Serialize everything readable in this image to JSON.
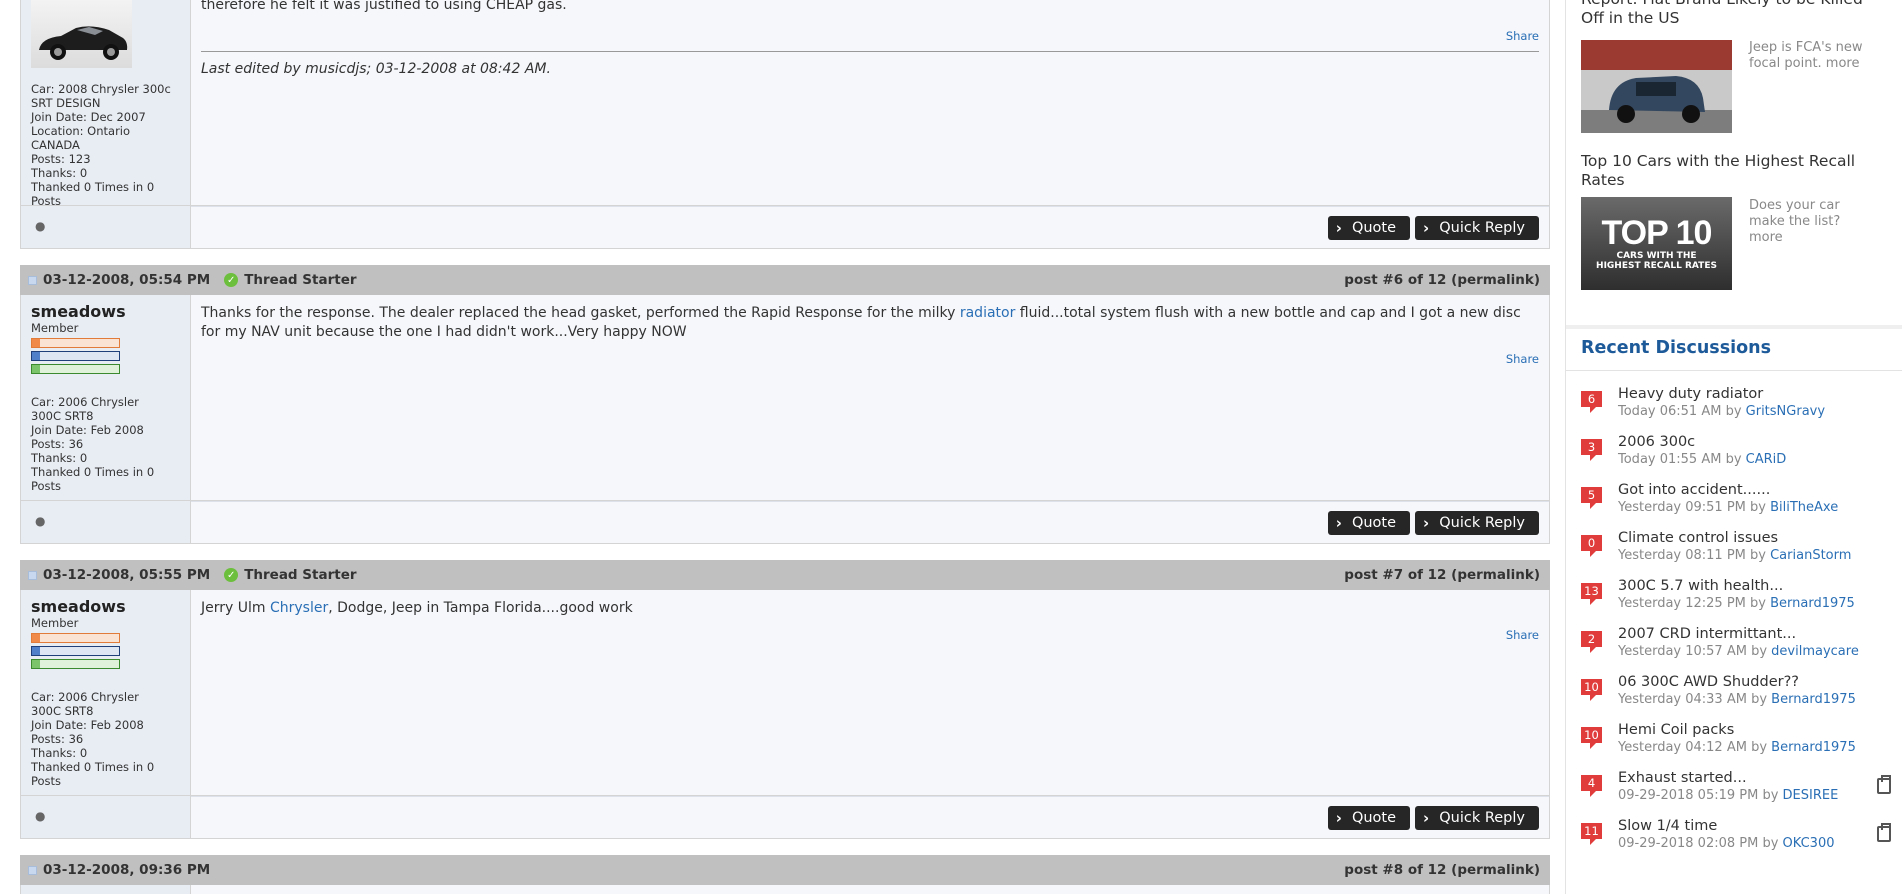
{
  "post5": {
    "text_tail": "therefore he felt it was justified to using CHEAP gas.",
    "share": "Share",
    "edited": "Last edited by musicdjs; 03-12-2008 at 08:42 AM.",
    "user_lines": [
      "Car: 2008 Chrysler 300c SRT DESIGN",
      "Join Date: Dec 2007",
      "Location: Ontario CANADA",
      "Posts: 123",
      "Thanks: 0",
      "Thanked 0 Times in 0 Posts"
    ],
    "quote": "Quote",
    "quick_reply": "Quick Reply"
  },
  "post6": {
    "date": "03-12-2008, 05:54 PM",
    "badge": "Thread Starter",
    "postnum": "post #6 of 12 (permalink)",
    "username": "smeadows",
    "role": "Member",
    "user_lines": [
      "Car: 2006 Chrysler 300C SRT8",
      "Join Date: Feb 2008",
      "Posts: 36",
      "Thanks: 0",
      "Thanked 0 Times in 0 Posts"
    ],
    "text_a": "Thanks for the response. The dealer replaced the head gasket, performed the Rapid Response for the milky ",
    "link": "radiator",
    "text_b": " fluid...total system flush with a new bottle and cap and I got a new disc for my NAV unit because the one I had didn't work...Very happy NOW",
    "share": "Share",
    "quote": "Quote",
    "quick_reply": "Quick Reply"
  },
  "post7": {
    "date": "03-12-2008, 05:55 PM",
    "badge": "Thread Starter",
    "postnum": "post #7 of 12 (permalink)",
    "username": "smeadows",
    "role": "Member",
    "user_lines": [
      "Car: 2006 Chrysler 300C SRT8",
      "Join Date: Feb 2008",
      "Posts: 36",
      "Thanks: 0",
      "Thanked 0 Times in 0 Posts"
    ],
    "text_a": "Jerry Ulm ",
    "link": "Chrysler",
    "text_b": ", Dodge, Jeep in Tampa Florida....good work",
    "share": "Share",
    "quote": "Quote",
    "quick_reply": "Quick Reply"
  },
  "post8": {
    "date": "03-12-2008, 09:36 PM",
    "postnum": "post #8 of 12 (permalink)"
  },
  "sidebar": {
    "article1": {
      "title": "Report: Fiat Brand Likely to be Killed Off in the US",
      "desc": "Jeep is FCA's new focal point. more"
    },
    "article2": {
      "title": "Top 10 Cars with the Highest Recall Rates",
      "desc": "Does your car make the list? more",
      "thumb_big": "TOP 10",
      "thumb_small1": "CARS WITH THE",
      "thumb_small2": "HIGHEST RECALL RATES"
    },
    "recent_title": "Recent Discussions",
    "discussions": [
      {
        "count": "6",
        "title": "Heavy duty radiator",
        "meta": "Today 06:51 AM by ",
        "user": "GritsNGravy",
        "clip": false
      },
      {
        "count": "3",
        "title": "2006 300c",
        "meta": "Today 01:55 AM by ",
        "user": "CARiD",
        "clip": false
      },
      {
        "count": "5",
        "title": "Got into accident......",
        "meta": "Yesterday 09:51 PM by ",
        "user": "BiliTheAxe",
        "clip": false
      },
      {
        "count": "0",
        "title": "Climate control issues",
        "meta": "Yesterday 08:11 PM by ",
        "user": "CarianStorm",
        "clip": false
      },
      {
        "count": "13",
        "title": "300C 5.7 with health...",
        "meta": "Yesterday 12:25 PM by ",
        "user": "Bernard1975",
        "clip": false
      },
      {
        "count": "2",
        "title": "2007 CRD intermittant...",
        "meta": "Yesterday 10:57 AM by ",
        "user": "devilmaycare",
        "clip": false
      },
      {
        "count": "10",
        "title": "06 300C AWD Shudder??",
        "meta": "Yesterday 04:33 AM by ",
        "user": "Bernard1975",
        "clip": false
      },
      {
        "count": "10",
        "title": "Hemi Coil packs",
        "meta": "Yesterday 04:12 AM by ",
        "user": "Bernard1975",
        "clip": false
      },
      {
        "count": "4",
        "title": "Exhaust started...",
        "meta": "09-29-2018 05:19 PM by ",
        "user": "DESIREE",
        "clip": true
      },
      {
        "count": "11",
        "title": "Slow 1/4 time",
        "meta": "09-29-2018 02:08 PM by ",
        "user": "OKC300",
        "clip": true
      }
    ]
  },
  "colors": {
    "header_bg": "#c0c0c0",
    "badge_red": "#e03c3c",
    "link_blue": "#2a6fb5",
    "button_dark": "#262626"
  }
}
